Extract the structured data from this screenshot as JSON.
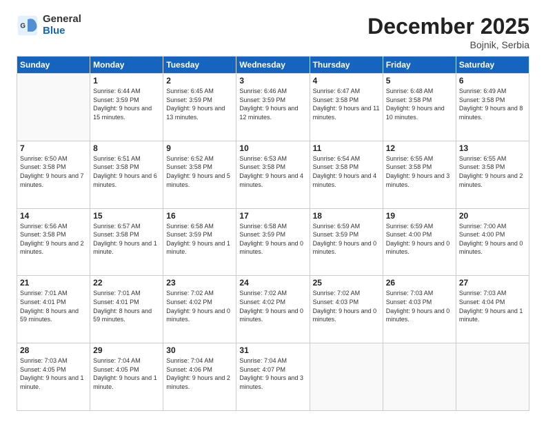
{
  "header": {
    "logo_general": "General",
    "logo_blue": "Blue",
    "title": "December 2025",
    "location": "Bojnik, Serbia"
  },
  "days_of_week": [
    "Sunday",
    "Monday",
    "Tuesday",
    "Wednesday",
    "Thursday",
    "Friday",
    "Saturday"
  ],
  "weeks": [
    [
      {
        "day": "",
        "empty": true
      },
      {
        "day": "1",
        "sunrise": "Sunrise: 6:44 AM",
        "sunset": "Sunset: 3:59 PM",
        "daylight": "Daylight: 9 hours and 15 minutes."
      },
      {
        "day": "2",
        "sunrise": "Sunrise: 6:45 AM",
        "sunset": "Sunset: 3:59 PM",
        "daylight": "Daylight: 9 hours and 13 minutes."
      },
      {
        "day": "3",
        "sunrise": "Sunrise: 6:46 AM",
        "sunset": "Sunset: 3:59 PM",
        "daylight": "Daylight: 9 hours and 12 minutes."
      },
      {
        "day": "4",
        "sunrise": "Sunrise: 6:47 AM",
        "sunset": "Sunset: 3:58 PM",
        "daylight": "Daylight: 9 hours and 11 minutes."
      },
      {
        "day": "5",
        "sunrise": "Sunrise: 6:48 AM",
        "sunset": "Sunset: 3:58 PM",
        "daylight": "Daylight: 9 hours and 10 minutes."
      },
      {
        "day": "6",
        "sunrise": "Sunrise: 6:49 AM",
        "sunset": "Sunset: 3:58 PM",
        "daylight": "Daylight: 9 hours and 8 minutes."
      }
    ],
    [
      {
        "day": "7",
        "sunrise": "Sunrise: 6:50 AM",
        "sunset": "Sunset: 3:58 PM",
        "daylight": "Daylight: 9 hours and 7 minutes."
      },
      {
        "day": "8",
        "sunrise": "Sunrise: 6:51 AM",
        "sunset": "Sunset: 3:58 PM",
        "daylight": "Daylight: 9 hours and 6 minutes."
      },
      {
        "day": "9",
        "sunrise": "Sunrise: 6:52 AM",
        "sunset": "Sunset: 3:58 PM",
        "daylight": "Daylight: 9 hours and 5 minutes."
      },
      {
        "day": "10",
        "sunrise": "Sunrise: 6:53 AM",
        "sunset": "Sunset: 3:58 PM",
        "daylight": "Daylight: 9 hours and 4 minutes."
      },
      {
        "day": "11",
        "sunrise": "Sunrise: 6:54 AM",
        "sunset": "Sunset: 3:58 PM",
        "daylight": "Daylight: 9 hours and 4 minutes."
      },
      {
        "day": "12",
        "sunrise": "Sunrise: 6:55 AM",
        "sunset": "Sunset: 3:58 PM",
        "daylight": "Daylight: 9 hours and 3 minutes."
      },
      {
        "day": "13",
        "sunrise": "Sunrise: 6:55 AM",
        "sunset": "Sunset: 3:58 PM",
        "daylight": "Daylight: 9 hours and 2 minutes."
      }
    ],
    [
      {
        "day": "14",
        "sunrise": "Sunrise: 6:56 AM",
        "sunset": "Sunset: 3:58 PM",
        "daylight": "Daylight: 9 hours and 2 minutes."
      },
      {
        "day": "15",
        "sunrise": "Sunrise: 6:57 AM",
        "sunset": "Sunset: 3:58 PM",
        "daylight": "Daylight: 9 hours and 1 minute."
      },
      {
        "day": "16",
        "sunrise": "Sunrise: 6:58 AM",
        "sunset": "Sunset: 3:59 PM",
        "daylight": "Daylight: 9 hours and 1 minute."
      },
      {
        "day": "17",
        "sunrise": "Sunrise: 6:58 AM",
        "sunset": "Sunset: 3:59 PM",
        "daylight": "Daylight: 9 hours and 0 minutes."
      },
      {
        "day": "18",
        "sunrise": "Sunrise: 6:59 AM",
        "sunset": "Sunset: 3:59 PM",
        "daylight": "Daylight: 9 hours and 0 minutes."
      },
      {
        "day": "19",
        "sunrise": "Sunrise: 6:59 AM",
        "sunset": "Sunset: 4:00 PM",
        "daylight": "Daylight: 9 hours and 0 minutes."
      },
      {
        "day": "20",
        "sunrise": "Sunrise: 7:00 AM",
        "sunset": "Sunset: 4:00 PM",
        "daylight": "Daylight: 9 hours and 0 minutes."
      }
    ],
    [
      {
        "day": "21",
        "sunrise": "Sunrise: 7:01 AM",
        "sunset": "Sunset: 4:01 PM",
        "daylight": "Daylight: 8 hours and 59 minutes."
      },
      {
        "day": "22",
        "sunrise": "Sunrise: 7:01 AM",
        "sunset": "Sunset: 4:01 PM",
        "daylight": "Daylight: 8 hours and 59 minutes."
      },
      {
        "day": "23",
        "sunrise": "Sunrise: 7:02 AM",
        "sunset": "Sunset: 4:02 PM",
        "daylight": "Daylight: 9 hours and 0 minutes."
      },
      {
        "day": "24",
        "sunrise": "Sunrise: 7:02 AM",
        "sunset": "Sunset: 4:02 PM",
        "daylight": "Daylight: 9 hours and 0 minutes."
      },
      {
        "day": "25",
        "sunrise": "Sunrise: 7:02 AM",
        "sunset": "Sunset: 4:03 PM",
        "daylight": "Daylight: 9 hours and 0 minutes."
      },
      {
        "day": "26",
        "sunrise": "Sunrise: 7:03 AM",
        "sunset": "Sunset: 4:03 PM",
        "daylight": "Daylight: 9 hours and 0 minutes."
      },
      {
        "day": "27",
        "sunrise": "Sunrise: 7:03 AM",
        "sunset": "Sunset: 4:04 PM",
        "daylight": "Daylight: 9 hours and 1 minute."
      }
    ],
    [
      {
        "day": "28",
        "sunrise": "Sunrise: 7:03 AM",
        "sunset": "Sunset: 4:05 PM",
        "daylight": "Daylight: 9 hours and 1 minute."
      },
      {
        "day": "29",
        "sunrise": "Sunrise: 7:04 AM",
        "sunset": "Sunset: 4:05 PM",
        "daylight": "Daylight: 9 hours and 1 minute."
      },
      {
        "day": "30",
        "sunrise": "Sunrise: 7:04 AM",
        "sunset": "Sunset: 4:06 PM",
        "daylight": "Daylight: 9 hours and 2 minutes."
      },
      {
        "day": "31",
        "sunrise": "Sunrise: 7:04 AM",
        "sunset": "Sunset: 4:07 PM",
        "daylight": "Daylight: 9 hours and 3 minutes."
      },
      {
        "day": "",
        "empty": true
      },
      {
        "day": "",
        "empty": true
      },
      {
        "day": "",
        "empty": true
      }
    ]
  ]
}
